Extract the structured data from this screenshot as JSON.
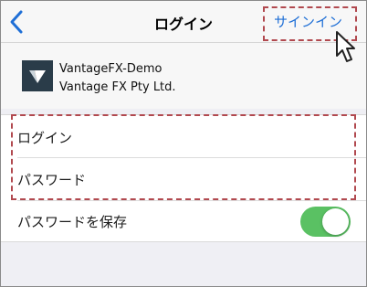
{
  "navbar": {
    "title": "ログイン",
    "signin_label": "サインイン"
  },
  "server": {
    "name": "VantageFX-Demo",
    "company": "Vantage FX Pty Ltd."
  },
  "form": {
    "login_placeholder": "ログイン",
    "password_placeholder": "パスワード",
    "save_password_label": "パスワードを保存",
    "save_password_enabled": true
  },
  "colors": {
    "accent": "#1f6fd6",
    "toggle_on": "#5ac163",
    "highlight": "#b1494f",
    "logo_bg": "#2a3c49"
  }
}
